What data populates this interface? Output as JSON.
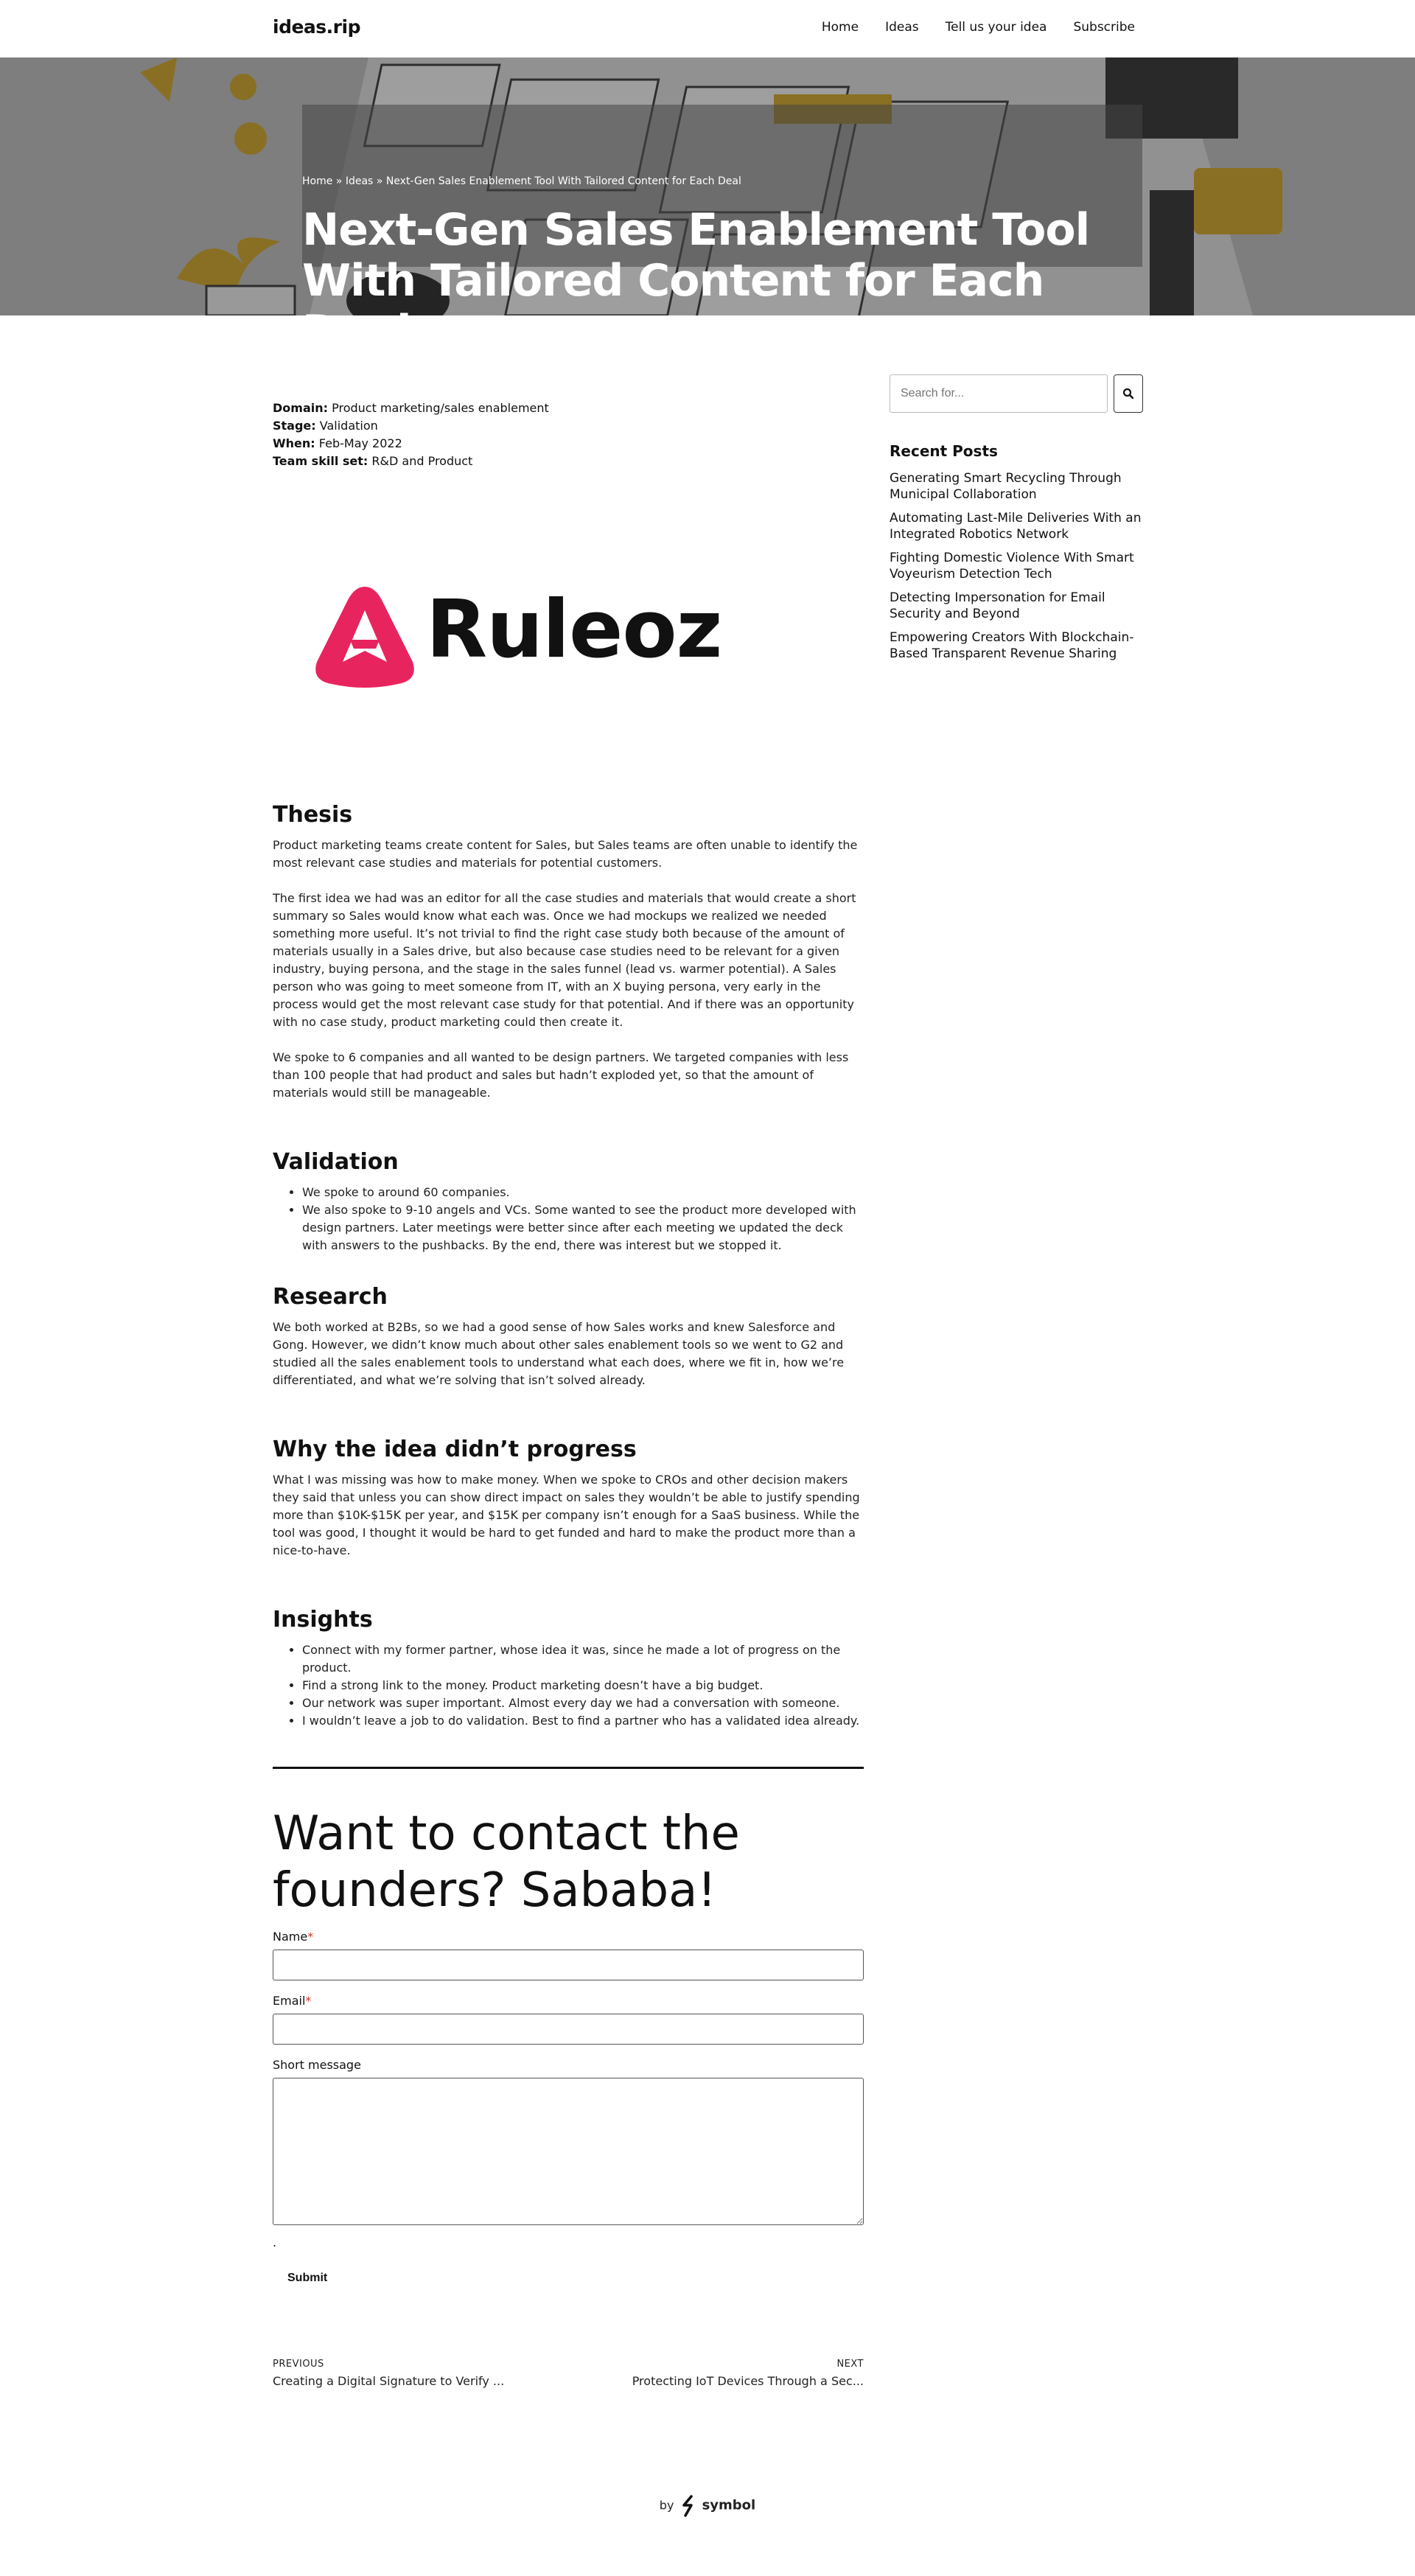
{
  "header": {
    "logo": "ideas.rip",
    "nav": [
      "Home",
      "Ideas",
      "Tell us your idea",
      "Subscribe"
    ]
  },
  "hero": {
    "breadcrumb": [
      "Home",
      "Ideas",
      "Next-Gen Sales Enablement Tool With Tailored Content for Each Deal"
    ],
    "breadcrumb_sep": "»",
    "title_line1": "Next-Gen Sales Enablement Tool",
    "title_line2": "With Tailored Content for Each Deal"
  },
  "meta": [
    {
      "label": "Domain:",
      "value": "Product marketing/sales enablement"
    },
    {
      "label": "Stage:",
      "value": "Validation"
    },
    {
      "label": "When:",
      "value": "Feb-May 2022"
    },
    {
      "label": "Team skill set:",
      "value": "R&D and Product"
    }
  ],
  "featured": {
    "logo_text": "Ruleoz",
    "logo_color": "#e8245f"
  },
  "thesis": {
    "title": "Thesis",
    "p1": "Product marketing teams create content for Sales, but Sales teams are often unable to identify the most relevant case studies and materials for potential customers.",
    "p2": "The first idea we had was an editor for all the case studies and materials that would create a short summary so Sales would know what each was. Once we had mockups we realized we needed something more useful. It’s not trivial to find the right case study both because of the amount of materials usually in a Sales drive, but also because case studies need to be relevant for a given industry, buying persona, and the stage in the sales funnel (lead vs. warmer potential). A Sales person who was going to meet someone from IT, with an X buying persona, very early in the process would get the most relevant case study for that potential. And if there was an opportunity with no case study, product marketing could then create it.",
    "p3": "We spoke to 6 companies and all wanted to be design partners. We targeted companies with less than 100 people that had product and sales but hadn’t exploded yet, so that the amount of materials would still be manageable."
  },
  "validation": {
    "title": "Validation",
    "items": [
      "We spoke to around 60 companies.",
      "We also spoke to 9-10 angels and VCs. Some wanted to see the product more developed with design partners. Later meetings were better since after each meeting we updated the deck with answers to the pushbacks. By the end, there was interest but we stopped it."
    ]
  },
  "research": {
    "title": "Research",
    "p1": "We both worked at B2Bs, so we had a good sense of how Sales works and knew Salesforce and Gong. However, we didn’t know much about other sales enablement tools so we went to G2 and studied all the sales enablement tools to understand what each does, where we fit in, how we’re differentiated, and what we’re solving that isn’t solved already."
  },
  "why": {
    "title": "Why the idea didn’t progress",
    "p1": "What I was missing was how to make money. When we spoke to CROs and other decision makers they said that unless you can show direct impact on sales they wouldn’t be able to justify spending more than $10K-$15K per year, and $15K per company isn’t enough for a SaaS business. While the tool was good, I thought it would be hard to get funded and hard to make the product more than a nice-to-have."
  },
  "insights": {
    "title": "Insights",
    "items": [
      "Connect with my former partner, whose idea it was, since he made a lot of progress on the product.",
      "Find a strong link to the money. Product marketing doesn’t have a big budget.",
      "Our network was super important. Almost every day we had a conversation with someone.",
      "I wouldn’t leave a job to do validation. Best to find a partner who has a validated idea already."
    ]
  },
  "contact": {
    "title_line1": "Want to contact the",
    "title_line2": "founders? Sababa!",
    "name_label": "Name",
    "email_label": "Email",
    "message_label": "Short message",
    "required_mark": "*",
    "dot": ".",
    "submit": "Submit"
  },
  "post_nav": {
    "prev_label": "PREVIOUS",
    "prev_title": "Creating a Digital Signature to Verify ...",
    "next_label": "NEXT",
    "next_title": "Protecting IoT Devices Through a Sec..."
  },
  "footer": {
    "by": "by",
    "brand": "symbol"
  },
  "sidebar": {
    "search_placeholder": "Search for...",
    "recent_title": "Recent Posts",
    "recent": [
      "Generating Smart Recycling Through Municipal Collaboration",
      "Automating Last-Mile Deliveries With an Integrated Robotics Network",
      "Fighting Domestic Violence With Smart Voyeurism Detection Tech",
      "Detecting Impersonation for Email Security and Beyond",
      "Empowering Creators With Blockchain-Based Transparent Revenue Sharing"
    ]
  }
}
